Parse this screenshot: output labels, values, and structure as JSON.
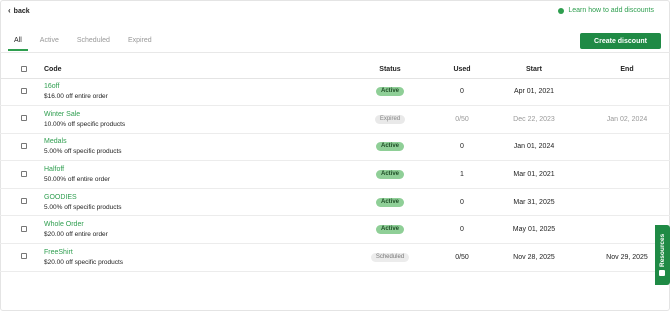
{
  "nav": {
    "back_label": "back",
    "learn_label": "Learn how to add discounts"
  },
  "tabs": [
    {
      "label": "All",
      "active": true
    },
    {
      "label": "Active",
      "active": false
    },
    {
      "label": "Scheduled",
      "active": false
    },
    {
      "label": "Expired",
      "active": false
    }
  ],
  "toolbar": {
    "create_label": "Create discount"
  },
  "table": {
    "headers": {
      "code": "Code",
      "status": "Status",
      "used": "Used",
      "start": "Start",
      "end": "End"
    },
    "rows": [
      {
        "code": "16off",
        "desc": "$16.00 off entire order",
        "status": "Active",
        "status_kind": "active",
        "used": "0",
        "start": "Apr 01, 2021",
        "end": "",
        "muted": false
      },
      {
        "code": "Winter Sale",
        "desc": "10.00% off specific products",
        "status": "Expired",
        "status_kind": "expired",
        "used": "0/50",
        "start": "Dec 22, 2023",
        "end": "Jan 02, 2024",
        "muted": true
      },
      {
        "code": "Medals",
        "desc": "5.00% off specific products",
        "status": "Active",
        "status_kind": "active",
        "used": "0",
        "start": "Jan 01, 2024",
        "end": "",
        "muted": false
      },
      {
        "code": "Halfoff",
        "desc": "50.00% off entire order",
        "status": "Active",
        "status_kind": "active",
        "used": "1",
        "start": "Mar 01, 2021",
        "end": "",
        "muted": false
      },
      {
        "code": "GOODIES",
        "desc": "5.00% off specific products",
        "status": "Active",
        "status_kind": "active",
        "used": "0",
        "start": "Mar 31, 2025",
        "end": "",
        "muted": false
      },
      {
        "code": "Whole Order",
        "desc": "$20.00 off entire order",
        "status": "Active",
        "status_kind": "active",
        "used": "0",
        "start": "May 01, 2025",
        "end": "",
        "muted": false
      },
      {
        "code": "FreeShirt",
        "desc": "$20.00 off specific products",
        "status": "Scheduled",
        "status_kind": "scheduled",
        "used": "0/50",
        "start": "Nov 28, 2025",
        "end": "Nov 29, 2025",
        "muted": false
      }
    ]
  },
  "resources": {
    "label": "Resources"
  },
  "colors": {
    "accent": "#2e9e4f",
    "button": "#1f8a45"
  }
}
